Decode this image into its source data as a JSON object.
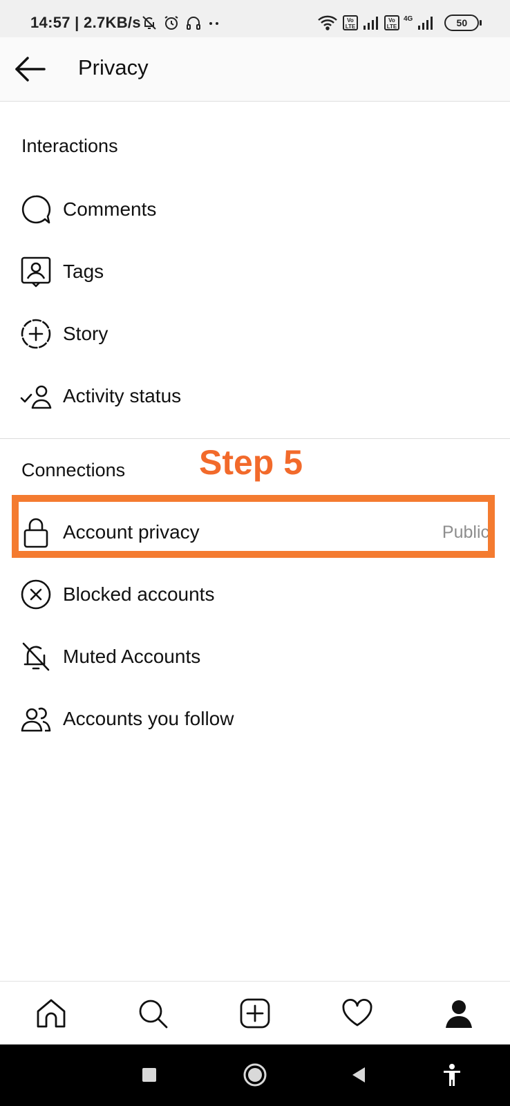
{
  "status_bar": {
    "time_speed": "14:57 | 2.7KB/s",
    "battery": "50",
    "volte1": "Vo LTE",
    "volte2": "Vo LTE",
    "net": "4G"
  },
  "header": {
    "title": "Privacy"
  },
  "interactions": {
    "title": "Interactions",
    "items": [
      {
        "label": "Comments",
        "icon": "comment-icon"
      },
      {
        "label": "Tags",
        "icon": "tag-person-icon"
      },
      {
        "label": "Story",
        "icon": "story-add-icon"
      },
      {
        "label": "Activity status",
        "icon": "activity-status-icon"
      }
    ]
  },
  "connections": {
    "title": "Connections",
    "items": [
      {
        "label": "Account privacy",
        "value": "Public",
        "icon": "lock-icon"
      },
      {
        "label": "Blocked accounts",
        "icon": "blocked-icon"
      },
      {
        "label": "Muted Accounts",
        "icon": "muted-bell-icon"
      },
      {
        "label": "Accounts you follow",
        "icon": "people-icon"
      }
    ]
  },
  "annotation": {
    "step": "Step 5",
    "color": "#f47b30"
  },
  "bottom_nav": [
    "home-icon",
    "search-icon",
    "add-post-icon",
    "heart-icon",
    "profile-icon"
  ]
}
